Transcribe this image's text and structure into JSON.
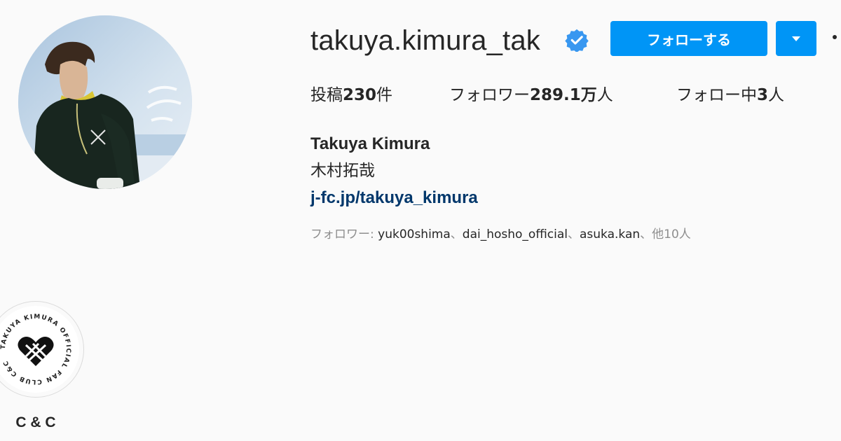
{
  "profile": {
    "username": "takuya.kimura_tak",
    "verified_icon": "verified-badge-icon",
    "follow_label": "フォローする",
    "dropdown_icon": "chevron-down-icon",
    "more_icon": "more-options-icon"
  },
  "stats": {
    "posts_label": "投稿",
    "posts_count": "230",
    "posts_suffix": "件",
    "followers_label": "フォロワー",
    "followers_count": "289.1万",
    "followers_suffix": "人",
    "following_label": "フォロー中",
    "following_count": "3",
    "following_suffix": "人"
  },
  "bio": {
    "full_name": "Takuya Kimura",
    "line1": "木村拓哉",
    "link": "j-fc.jp/takuya_kimura"
  },
  "followed_by": {
    "prefix": "フォロワー: ",
    "names": [
      "yuk00shima",
      "dai_hosho_official",
      "asuka.kan"
    ],
    "separator": "、",
    "suffix": "他10人"
  },
  "highlights": [
    {
      "label": "C & C",
      "logo_text": "TAKUYA KIMURA OFFICIAL FAN CLUB C&C"
    }
  ],
  "colors": {
    "accent": "#0095f6",
    "link": "#00376b",
    "muted": "#8e8e8e",
    "text": "#262626",
    "background": "#fafafa"
  }
}
